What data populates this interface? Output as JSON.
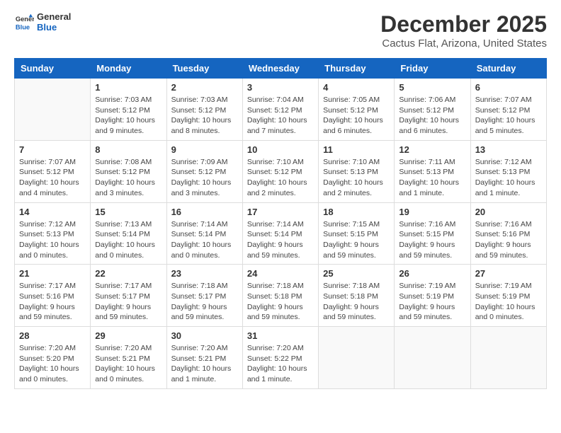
{
  "logo": {
    "general": "General",
    "blue": "Blue"
  },
  "title": "December 2025",
  "location": "Cactus Flat, Arizona, United States",
  "days_header": [
    "Sunday",
    "Monday",
    "Tuesday",
    "Wednesday",
    "Thursday",
    "Friday",
    "Saturday"
  ],
  "weeks": [
    [
      {
        "day": "",
        "info": ""
      },
      {
        "day": "1",
        "info": "Sunrise: 7:03 AM\nSunset: 5:12 PM\nDaylight: 10 hours\nand 9 minutes."
      },
      {
        "day": "2",
        "info": "Sunrise: 7:03 AM\nSunset: 5:12 PM\nDaylight: 10 hours\nand 8 minutes."
      },
      {
        "day": "3",
        "info": "Sunrise: 7:04 AM\nSunset: 5:12 PM\nDaylight: 10 hours\nand 7 minutes."
      },
      {
        "day": "4",
        "info": "Sunrise: 7:05 AM\nSunset: 5:12 PM\nDaylight: 10 hours\nand 6 minutes."
      },
      {
        "day": "5",
        "info": "Sunrise: 7:06 AM\nSunset: 5:12 PM\nDaylight: 10 hours\nand 6 minutes."
      },
      {
        "day": "6",
        "info": "Sunrise: 7:07 AM\nSunset: 5:12 PM\nDaylight: 10 hours\nand 5 minutes."
      }
    ],
    [
      {
        "day": "7",
        "info": "Sunrise: 7:07 AM\nSunset: 5:12 PM\nDaylight: 10 hours\nand 4 minutes."
      },
      {
        "day": "8",
        "info": "Sunrise: 7:08 AM\nSunset: 5:12 PM\nDaylight: 10 hours\nand 3 minutes."
      },
      {
        "day": "9",
        "info": "Sunrise: 7:09 AM\nSunset: 5:12 PM\nDaylight: 10 hours\nand 3 minutes."
      },
      {
        "day": "10",
        "info": "Sunrise: 7:10 AM\nSunset: 5:12 PM\nDaylight: 10 hours\nand 2 minutes."
      },
      {
        "day": "11",
        "info": "Sunrise: 7:10 AM\nSunset: 5:13 PM\nDaylight: 10 hours\nand 2 minutes."
      },
      {
        "day": "12",
        "info": "Sunrise: 7:11 AM\nSunset: 5:13 PM\nDaylight: 10 hours\nand 1 minute."
      },
      {
        "day": "13",
        "info": "Sunrise: 7:12 AM\nSunset: 5:13 PM\nDaylight: 10 hours\nand 1 minute."
      }
    ],
    [
      {
        "day": "14",
        "info": "Sunrise: 7:12 AM\nSunset: 5:13 PM\nDaylight: 10 hours\nand 0 minutes."
      },
      {
        "day": "15",
        "info": "Sunrise: 7:13 AM\nSunset: 5:14 PM\nDaylight: 10 hours\nand 0 minutes."
      },
      {
        "day": "16",
        "info": "Sunrise: 7:14 AM\nSunset: 5:14 PM\nDaylight: 10 hours\nand 0 minutes."
      },
      {
        "day": "17",
        "info": "Sunrise: 7:14 AM\nSunset: 5:14 PM\nDaylight: 9 hours\nand 59 minutes."
      },
      {
        "day": "18",
        "info": "Sunrise: 7:15 AM\nSunset: 5:15 PM\nDaylight: 9 hours\nand 59 minutes."
      },
      {
        "day": "19",
        "info": "Sunrise: 7:16 AM\nSunset: 5:15 PM\nDaylight: 9 hours\nand 59 minutes."
      },
      {
        "day": "20",
        "info": "Sunrise: 7:16 AM\nSunset: 5:16 PM\nDaylight: 9 hours\nand 59 minutes."
      }
    ],
    [
      {
        "day": "21",
        "info": "Sunrise: 7:17 AM\nSunset: 5:16 PM\nDaylight: 9 hours\nand 59 minutes."
      },
      {
        "day": "22",
        "info": "Sunrise: 7:17 AM\nSunset: 5:17 PM\nDaylight: 9 hours\nand 59 minutes."
      },
      {
        "day": "23",
        "info": "Sunrise: 7:18 AM\nSunset: 5:17 PM\nDaylight: 9 hours\nand 59 minutes."
      },
      {
        "day": "24",
        "info": "Sunrise: 7:18 AM\nSunset: 5:18 PM\nDaylight: 9 hours\nand 59 minutes."
      },
      {
        "day": "25",
        "info": "Sunrise: 7:18 AM\nSunset: 5:18 PM\nDaylight: 9 hours\nand 59 minutes."
      },
      {
        "day": "26",
        "info": "Sunrise: 7:19 AM\nSunset: 5:19 PM\nDaylight: 9 hours\nand 59 minutes."
      },
      {
        "day": "27",
        "info": "Sunrise: 7:19 AM\nSunset: 5:19 PM\nDaylight: 10 hours\nand 0 minutes."
      }
    ],
    [
      {
        "day": "28",
        "info": "Sunrise: 7:20 AM\nSunset: 5:20 PM\nDaylight: 10 hours\nand 0 minutes."
      },
      {
        "day": "29",
        "info": "Sunrise: 7:20 AM\nSunset: 5:21 PM\nDaylight: 10 hours\nand 0 minutes."
      },
      {
        "day": "30",
        "info": "Sunrise: 7:20 AM\nSunset: 5:21 PM\nDaylight: 10 hours\nand 1 minute."
      },
      {
        "day": "31",
        "info": "Sunrise: 7:20 AM\nSunset: 5:22 PM\nDaylight: 10 hours\nand 1 minute."
      },
      {
        "day": "",
        "info": ""
      },
      {
        "day": "",
        "info": ""
      },
      {
        "day": "",
        "info": ""
      }
    ]
  ]
}
